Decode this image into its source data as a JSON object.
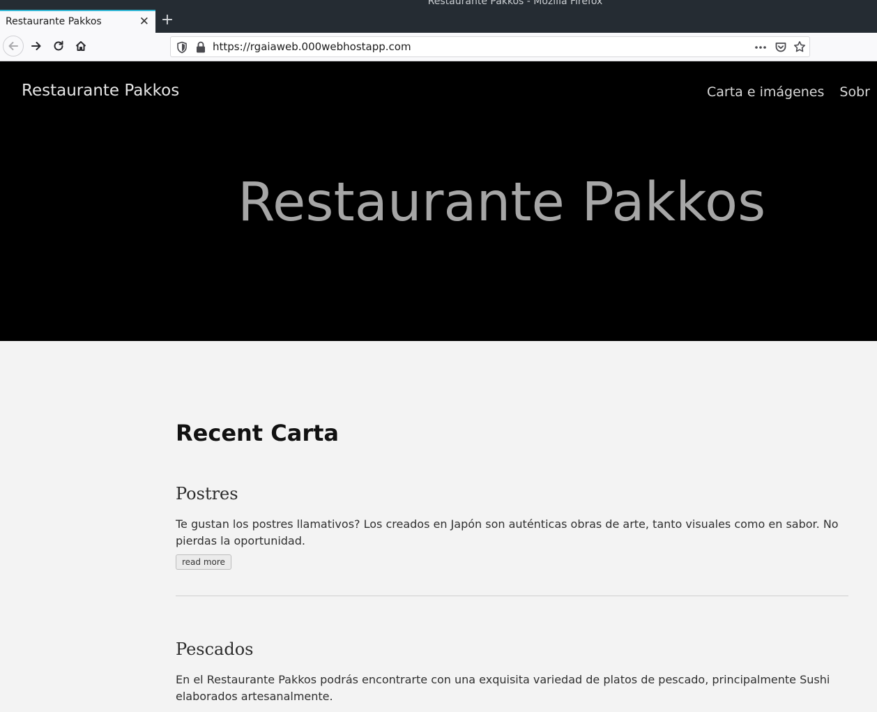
{
  "window": {
    "title": "Restaurante Pakkos - Mozilla Firefox"
  },
  "browser": {
    "tab_title": "Restaurante Pakkos",
    "tab_close": "✕",
    "new_tab": "+",
    "url": "https://rgaiaweb.000webhostapp.com",
    "icons": [
      "back-arrow-icon",
      "forward-arrow-icon",
      "reload-icon",
      "home-icon",
      "shield-icon",
      "lock-icon",
      "more-icon",
      "pocket-icon",
      "star-icon"
    ]
  },
  "site": {
    "brand": "Restaurante Pakkos",
    "nav": [
      "Carta e imágenes",
      "Sobr"
    ],
    "hero_title": "Restaurante Pakkos"
  },
  "main": {
    "section_title": "Recent Carta",
    "posts": [
      {
        "title": "Postres",
        "excerpt": "Te gustan los postres llamativos? Los creados en Japón son auténticas obras de arte, tanto visuales como en sabor. No pierdas la oportunidad.",
        "button": "read more"
      },
      {
        "title": "Pescados",
        "excerpt": "En el Restaurante Pakkos podrás encontrarte con una exquisita variedad de platos de pescado, principalmente Sushi elaborados artesanalmente."
      }
    ]
  },
  "colors": {
    "titlebar": "#252c33",
    "tab_accent": "#35b7d5",
    "header_bg": "#000000",
    "page_bg": "#f3f3f3"
  }
}
